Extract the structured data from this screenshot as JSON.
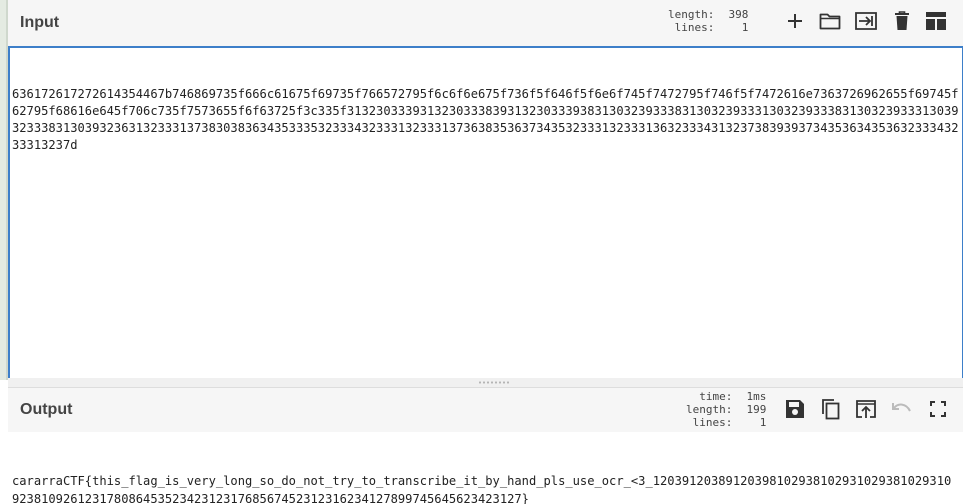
{
  "input": {
    "title": "Input",
    "stats": {
      "length_label": "length:",
      "length_value": "398",
      "lines_label": "lines:",
      "lines_value": "1"
    },
    "icons": [
      "add-icon",
      "folder-icon",
      "import-icon",
      "trash-icon",
      "layout-icon"
    ],
    "text": "636172617272614354467b746869735f666c61675f69735f766572795f6c6f6e675f736f5f646f5f6e6f745f7472795f746f5f7472616e7363726962655f69745f62795f68616e645f706c735f7573655f6f63725f3c335f313230333931323033383931323033393831303239333831303239333130323933383130323933313039323338313039323631323331373830383634353335323334323331323331373638353637343532333132333136323334313237383939373435363435363233343233313237d"
  },
  "output": {
    "title": "Output",
    "stats": {
      "time_label": "time:",
      "time_value": "1ms",
      "length_label": "length:",
      "length_value": "199",
      "lines_label": "lines:",
      "lines_value": "1"
    },
    "icons": [
      "save-icon",
      "copy-icon",
      "replace-input-icon",
      "undo-icon",
      "fullscreen-icon"
    ],
    "text": "cararraCTF{this_flag_is_very_long_so_do_not_try_to_transcribe_it_by_hand_pls_use_ocr_<3_120391203891203981029381029310293810293109238109261231780864535234231231768567452312316234127899745645623423127}"
  },
  "colors": {
    "accent": "#3d7fc9",
    "header_bg": "#f6f6f6",
    "icon": "#333333",
    "icon_disabled": "#bbbbbb"
  }
}
